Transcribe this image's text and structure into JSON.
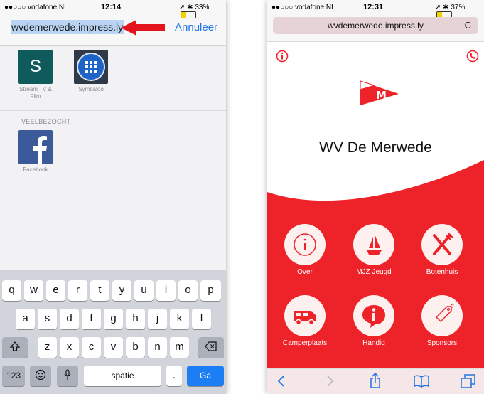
{
  "left_phone": {
    "status": {
      "carrier": "●●○○○ vodafone NL",
      "time": "12:14",
      "battery": "33%"
    },
    "url_text": "wvdemerwede.impress.ly",
    "cancel_label": "Annuleer",
    "favorites": [
      {
        "label": "Stream TV & Film",
        "tile_text": "S",
        "color": "#0f5a5a",
        "icon": "s-tile-icon"
      },
      {
        "label": "Symbaloo",
        "icon": "symbaloo-grid-icon",
        "color": "#2f3a48"
      }
    ],
    "section_title": "VEELBEZOCHT",
    "frequent": [
      {
        "label": "Facebook",
        "icon": "facebook-logo-icon",
        "color": "#3b5a9a"
      }
    ],
    "keyboard": {
      "row1": [
        "q",
        "w",
        "e",
        "r",
        "t",
        "y",
        "u",
        "i",
        "o",
        "p"
      ],
      "row2": [
        "a",
        "s",
        "d",
        "f",
        "g",
        "h",
        "j",
        "k",
        "l"
      ],
      "row3": [
        "z",
        "x",
        "c",
        "v",
        "b",
        "n",
        "m"
      ],
      "shift_icon": "shift-icon",
      "backspace_icon": "backspace-icon",
      "numbers_label": "123",
      "emoji_icon": "emoji-icon",
      "mic_icon": "microphone-icon",
      "space_label": "spatie",
      "period_label": ".",
      "go_label": "Ga"
    }
  },
  "right_phone": {
    "status": {
      "carrier": "●●○○○ vodafone NL",
      "time": "12:31",
      "battery": "37%"
    },
    "url_text": "wvdemerwede.impress.ly",
    "reload_icon": "reload-icon",
    "title": "WV De Merwede",
    "logo_text": "M",
    "accent_color": "#ee2229",
    "buttons": [
      {
        "label": "Over",
        "icon": "info-circle-icon"
      },
      {
        "label": "MJZ Jeugd",
        "icon": "sailboat-icon"
      },
      {
        "label": "Botenhuis",
        "icon": "fork-knife-icon"
      },
      {
        "label": "Camperplaats",
        "icon": "camper-van-icon"
      },
      {
        "label": "Handig",
        "icon": "info-bubble-icon"
      },
      {
        "label": "Sponsors",
        "icon": "price-tag-icon"
      }
    ]
  }
}
